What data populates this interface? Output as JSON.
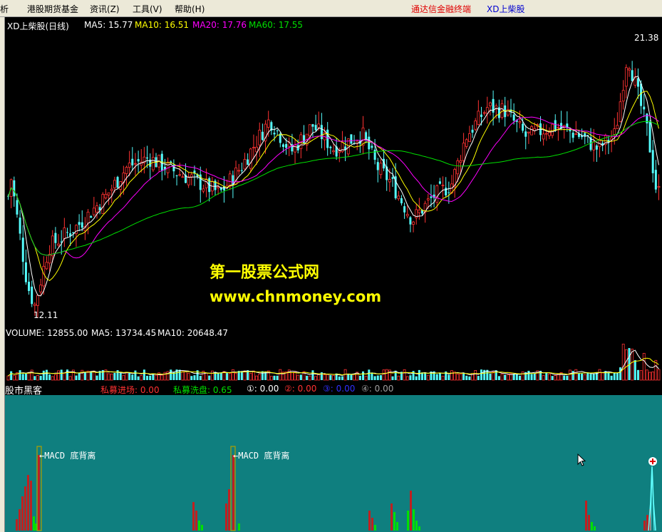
{
  "menu": {
    "items": [
      {
        "label": "析"
      },
      {
        "label": "港股期货基金"
      },
      {
        "label": "资讯(Z)"
      },
      {
        "label": "工具(V)"
      },
      {
        "label": "帮助(H)"
      }
    ],
    "brand": "通达信金融终端",
    "stock_tab": "XD上柴股"
  },
  "main": {
    "title": "XD上柴股(日线)",
    "ma5": "MA5: 15.77",
    "ma10": "MA10: 16.51",
    "ma20": "MA20: 17.76",
    "ma60": "MA60: 17.55",
    "high_label": "21.38",
    "low_label": "12.11"
  },
  "watermark": {
    "line1": "第一股票公式网",
    "line2": "www.chnmoney.com"
  },
  "volume": {
    "label": "VOLUME: 12855.00",
    "ma5": "MA5: 13734.45",
    "ma10": "MA10: 20648.47"
  },
  "indicator": {
    "name": "股市黑客",
    "entry": "私募进场: 0.00",
    "wash": "私募洗盘: 0.65",
    "s1": "①: 0.00",
    "s2": "②: 0.00",
    "s3": "③: 0.00",
    "s4": "④: 0.00",
    "annotation1": "←MACD 底背离",
    "annotation2": "←MACD 底背离"
  },
  "colors": {
    "up": "#ff3232",
    "down": "#54fcfc",
    "ma5": "#ffffff",
    "ma10": "#ffff00",
    "ma20": "#ff00ff",
    "ma60": "#00e000",
    "indicator_bg": "#0f7f7f"
  },
  "chart_data": {
    "type": "candlestick",
    "price_range": [
      12.11,
      21.38
    ],
    "last_ma": {
      "ma5": 15.77,
      "ma10": 16.51,
      "ma20": 17.76,
      "ma60": 17.55
    },
    "volume_last": 12855.0,
    "volume_ma5": 13734.45,
    "volume_ma10": 20648.47
  }
}
